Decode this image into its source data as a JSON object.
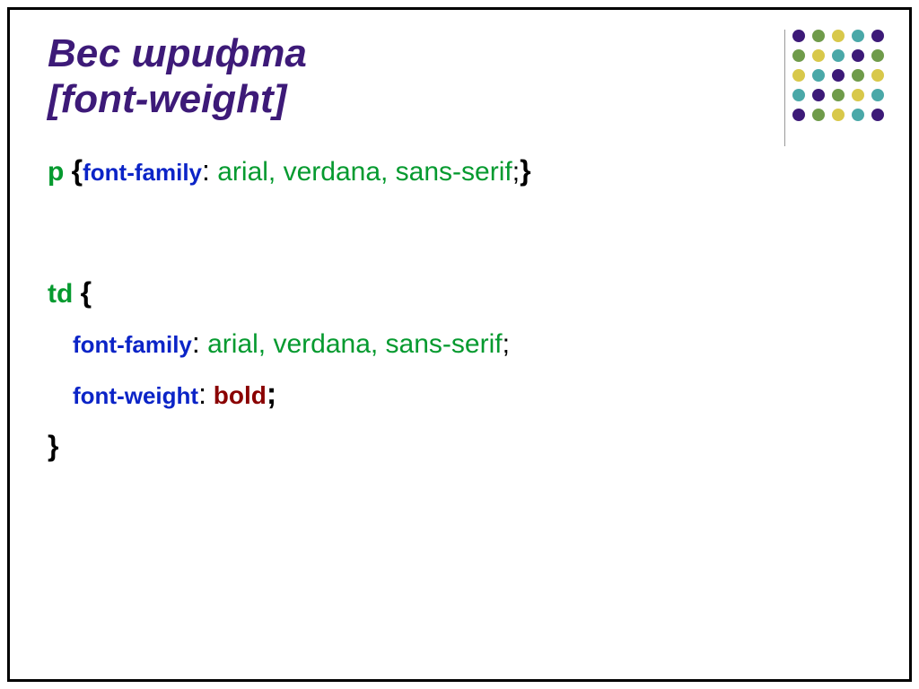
{
  "title_line1": "Вес шрифта",
  "title_line2": "[font-weight]",
  "rule1": {
    "selector": "p",
    "open": "{",
    "prop": "font-family",
    "colon": ":",
    "value": " arial, verdana, sans-serif",
    "semi": ";",
    "close": "}"
  },
  "rule2": {
    "selector": "td",
    "open": "{",
    "line1": {
      "prop": "font-family",
      "colon": ":",
      "value": " arial, verdana, sans-serif",
      "semi": ";"
    },
    "line2": {
      "prop": "font-weight",
      "colon": ":",
      "value": " bold",
      "semi": ";"
    },
    "close": "}"
  }
}
